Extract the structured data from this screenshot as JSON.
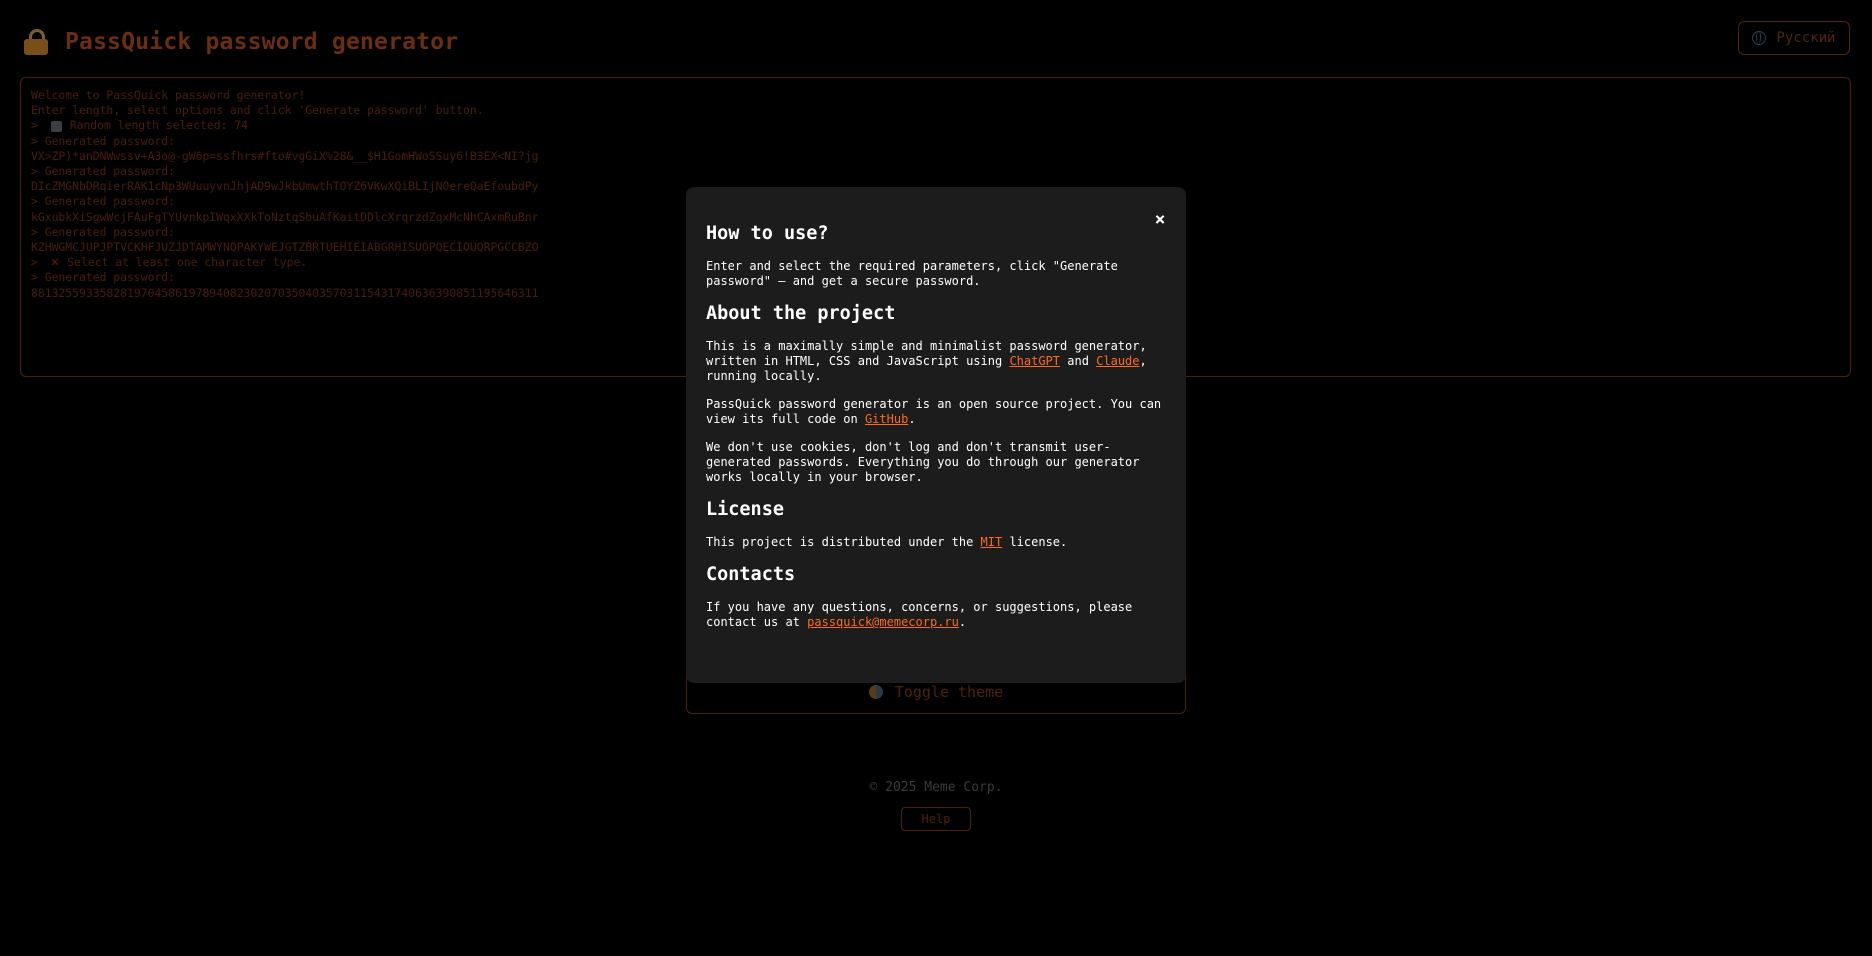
{
  "header": {
    "title": "PassQuick password generator",
    "language_button": "Русский"
  },
  "terminal": {
    "lines": [
      "Welcome to PassQuick password generator!",
      "Enter length, select options and click 'Generate password' button.",
      "> ",
      "Random length selected: 74",
      "> Generated password:",
      "VX>ZP)*anDNWwssv+A3o@-gW6p=ssfhrs#fto#vgGiX%28&__$H1GomHWoSSuy6!B3EX<NI?jg",
      "> Generated password:",
      "DIcZMGNbDRqierRAK1cNp3WUuuyvnJhjAD9wJkbUmwthTOYZ6VKwXQiBLIjN0ereQaEfoubdPy",
      "> Generated password:",
      "kGxubkXiSgwWcjFAuFgTYUvnkpIWqxXXkToNztqSbuAfKaitDDlcXrqrzdZqxMcNhCAxmRuBnr",
      "> Generated password:",
      "KZHWGMCJUPJPTVCKHFJUZJDTAMWYNQPAKYWEJGTZBRTUEHIEIABGRHISUOPQECIOUQRPGCCBZO",
      "> ",
      "Select at least one character type.",
      "> Generated password:",
      "88132559335828197045861978940823020703504035703115431740636390851195646311"
    ]
  },
  "theme_toggle": {
    "label": "Toggle theme"
  },
  "footer": {
    "copyright": "© 2025 Meme Corp.",
    "help_button": "Help"
  },
  "modal": {
    "close_label": "×",
    "how_to_use": {
      "heading": "How to use?",
      "text": "Enter and select the required parameters, click \"Generate password\" — and get a secure password."
    },
    "about": {
      "heading": "About the project",
      "p1_before": "This is a maximally simple and minimalist password generator, written in HTML, CSS and JavaScript using ",
      "link_chatgpt": "ChatGPT",
      "p1_and": " and ",
      "link_claude": "Claude",
      "p1_after": ", running locally.",
      "p2_before": "PassQuick password generator is an open source project. You can view its full code on ",
      "link_github": "GitHub",
      "p2_after": ".",
      "p3": "We don't use cookies, don't log and don't transmit user-generated passwords. Everything you do through our generator works locally in your browser."
    },
    "license": {
      "heading": "License",
      "text_before": "This project is distributed under the ",
      "link_mit": "MIT",
      "text_after": " license."
    },
    "contacts": {
      "heading": "Contacts",
      "text_before": "If you have any questions, concerns, or suggestions, please contact us at ",
      "link_email": "passquick@memecorp.ru",
      "text_after": "."
    }
  },
  "colors": {
    "background": "#000000",
    "accent": "#ff6a1a",
    "modal_background": "#1c1c1c",
    "dimmed_text": "#4a1d06"
  },
  "icons": {
    "title": "lock-icon",
    "language": "globe-icon",
    "random_length": "cube-icon",
    "error": "cross-icon",
    "theme": "half-moon-icon",
    "close": "close-icon"
  }
}
